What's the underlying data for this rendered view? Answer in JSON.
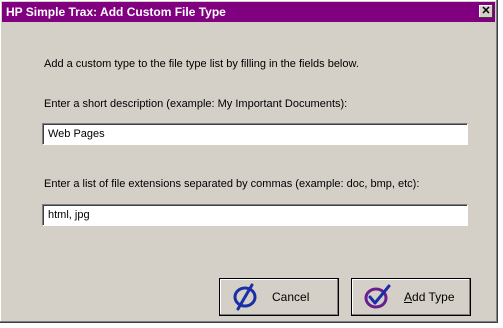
{
  "window": {
    "title": "HP Simple Trax: Add Custom File Type",
    "close_glyph": "✕"
  },
  "instructions": "Add a custom type to the file type list by filling in the fields below.",
  "description": {
    "label": "Enter a short description (example:  My Important Documents):",
    "value": "Web Pages"
  },
  "extensions": {
    "label": "Enter a list of file extensions separated by commas (example:  doc, bmp, etc):",
    "value": "html, jpg"
  },
  "buttons": {
    "cancel": {
      "label": "Cancel",
      "icon": "cancel-circle-slash-icon"
    },
    "add_type": {
      "label_first": "A",
      "label_rest": "dd Type",
      "icon": "checkmark-circle-icon"
    }
  },
  "colors": {
    "titlebar": "#800080",
    "icon_blue": "#1a2ea8",
    "icon_purple": "#6b1f8f",
    "dialog_bg": "#d4d0c8"
  }
}
